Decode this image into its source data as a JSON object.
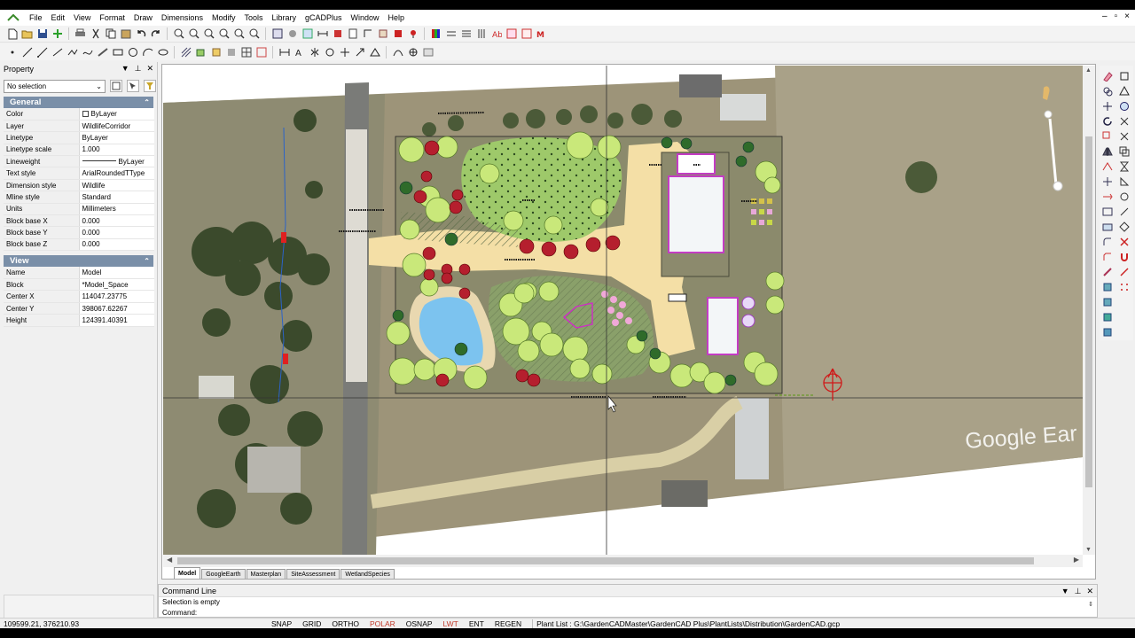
{
  "menu": [
    "File",
    "Edit",
    "View",
    "Format",
    "Draw",
    "Dimensions",
    "Modify",
    "Tools",
    "Library",
    "gCADPlus",
    "Window",
    "Help"
  ],
  "window_controls": [
    "–",
    "▫",
    "×"
  ],
  "property_panel": {
    "title": "Property",
    "selection": "No selection",
    "general": {
      "header": "General",
      "rows": [
        {
          "key": "Color",
          "value": "ByLayer"
        },
        {
          "key": "Layer",
          "value": "WildlifeCorridor"
        },
        {
          "key": "Linetype",
          "value": "ByLayer"
        },
        {
          "key": "Linetype scale",
          "value": "1.000"
        },
        {
          "key": "Lineweight",
          "value": "ByLayer"
        },
        {
          "key": "Text style",
          "value": "ArialRoundedTType"
        },
        {
          "key": "Dimension style",
          "value": "Wildlife"
        },
        {
          "key": "Mline style",
          "value": "Standard"
        },
        {
          "key": "Units",
          "value": "Millimeters"
        },
        {
          "key": "Block base X",
          "value": "0.000"
        },
        {
          "key": "Block base Y",
          "value": "0.000"
        },
        {
          "key": "Block base Z",
          "value": "0.000"
        }
      ]
    },
    "view": {
      "header": "View",
      "rows": [
        {
          "key": "Name",
          "value": "Model"
        },
        {
          "key": "Block",
          "value": "*Model_Space"
        },
        {
          "key": "Center X",
          "value": "114047.23775"
        },
        {
          "key": "Center Y",
          "value": "398067.62267"
        },
        {
          "key": "Height",
          "value": "124391.40391"
        }
      ]
    }
  },
  "drawing": {
    "watermark": "Google Ear",
    "tabs": [
      "Model",
      "GoogleEarth",
      "Masterplan",
      "SiteAssessment",
      "WetlandSpecies"
    ],
    "active_tab": "Model"
  },
  "command_line": {
    "title": "Command Line",
    "history": "Selection is empty",
    "prompt": "Command:"
  },
  "status": {
    "coords": "109599.21,  376210.93",
    "toggles": [
      {
        "label": "SNAP",
        "on": false
      },
      {
        "label": "GRID",
        "on": false
      },
      {
        "label": "ORTHO",
        "on": false
      },
      {
        "label": "POLAR",
        "on": true
      },
      {
        "label": "OSNAP",
        "on": false
      },
      {
        "label": "LWT",
        "on": true
      },
      {
        "label": "ENT",
        "on": false
      },
      {
        "label": "REGEN",
        "on": false
      }
    ],
    "plant_list": "Plant List : G:\\GardenCADMaster\\GardenCAD Plus\\PlantLists\\Distribution\\GardenCAD.gcp"
  },
  "colors": {
    "section_header": "#7a8fa8",
    "toggle_on": "#c23a2a",
    "tree_light": "#c9e87a",
    "tree_red": "#b51f2e",
    "path_sand": "#f4dfa6",
    "water": "#7cc3ef",
    "building_outline": "#c43cc4"
  }
}
